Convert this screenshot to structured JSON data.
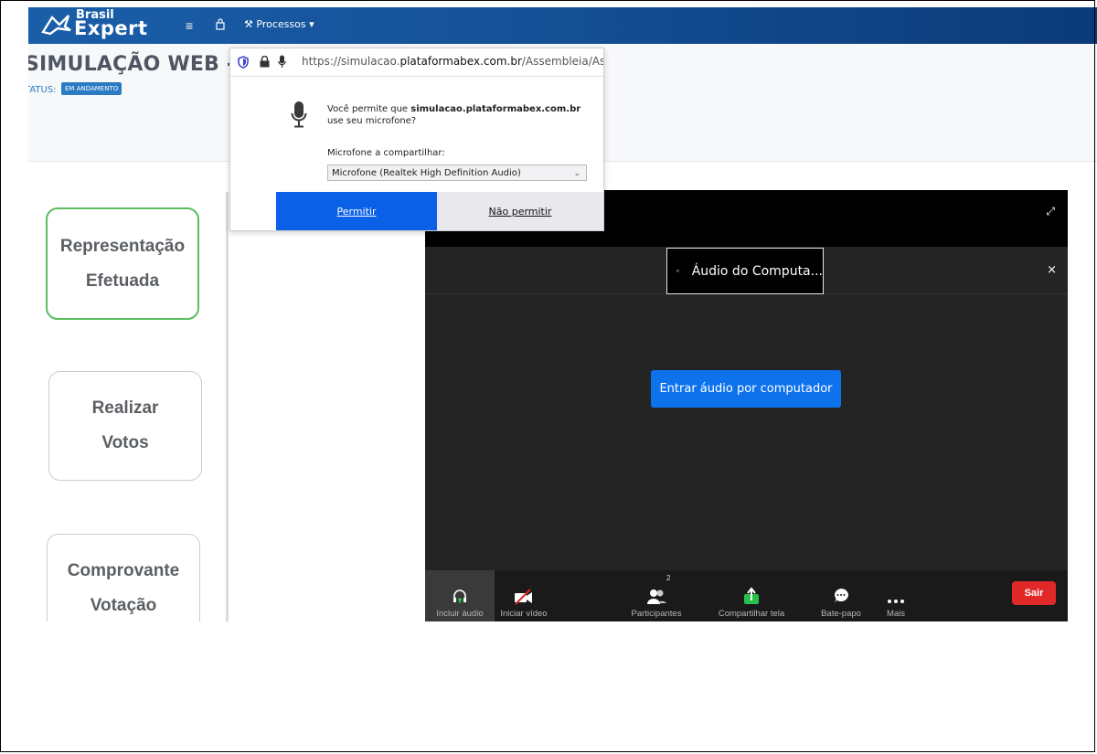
{
  "navbar": {
    "logo_brasil": "Brasil",
    "logo_expert": "Expert",
    "processos_label": "Processos"
  },
  "page": {
    "title": "SIMULAÇÃO WEB - EM",
    "status_label": "TATUS:",
    "status_badge": "EM ANDAMENTO"
  },
  "sidebar": {
    "cards": [
      {
        "line1": "Representação",
        "line2": "Efetuada"
      },
      {
        "line1": "Realizar",
        "line2": "Votos"
      },
      {
        "line1": "Comprovante",
        "line2": "Votação"
      }
    ]
  },
  "permission_popup": {
    "url_prefix": "https://simulacao.",
    "url_domain": "plataformabex.com.br",
    "url_suffix": "/Assembleia/As",
    "prompt_prefix": "Você permite que ",
    "prompt_host": "simulacao.plataformabex.com.br",
    "prompt_suffix": "use seu microfone?",
    "microphone_label": "Microfone a compartilhar:",
    "microphone_selected": "Microfone (Realtek High Definition Audio)",
    "allow_label": "Permitir",
    "deny_label": "Não permitir"
  },
  "zoom": {
    "audio_tab": "Áudio do Computa...",
    "close_glyph": "×",
    "join_button": "Entrar áudio por computador",
    "toolbar": {
      "audio": "Incluir áudio",
      "video": "Iniciar vídeo",
      "participants": "Participantes",
      "participants_count": "2",
      "share": "Compartilhar tela",
      "chat": "Bate-papo",
      "more": "Mais",
      "leave": "Sair"
    }
  },
  "colors": {
    "navbar": "#155197",
    "active_card_border": "#5cbd5f",
    "allow_button": "#0a60e6",
    "zoom_join": "#0e72ed",
    "zoom_leave": "#e02828",
    "share_icon": "#23c24a"
  }
}
